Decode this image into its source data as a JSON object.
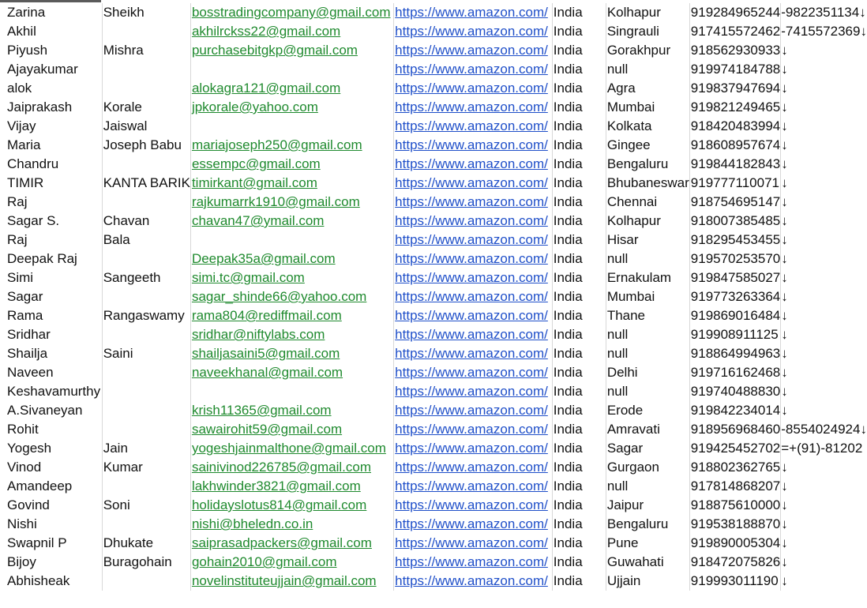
{
  "colors": {
    "email": "#1f8a2e",
    "url": "#1f4fc9",
    "arrow": "#3a8fe0"
  },
  "rows": [
    {
      "first": "Zarina",
      "last": "Sheikh",
      "email": "bosstradingcompany@gmail.com",
      "url": "https://www.amazon.com/",
      "country": "India",
      "city": "Kolhapur",
      "phone": "919284965244",
      "extra": "-9822351134↓"
    },
    {
      "first": "Akhil",
      "last": "",
      "email": "akhilrckss22@gmail.com",
      "url": "https://www.amazon.com/",
      "country": "India",
      "city": "Singrauli",
      "phone": "917415572462",
      "extra": "-7415572369↓"
    },
    {
      "first": "Piyush",
      "last": "Mishra",
      "email": "purchasebitgkp@gmail.com",
      "url": "https://www.amazon.com/",
      "country": "India",
      "city": "Gorakhpur",
      "phone": "918562930933",
      "extra": "↓"
    },
    {
      "first": "Ajayakumar",
      "last": "",
      "email": "",
      "url": "https://www.amazon.com/",
      "country": "India",
      "city": "null",
      "phone": "919974184788",
      "extra": "↓"
    },
    {
      "first": "alok",
      "last": "",
      "email": "alokagra121@gmail.com",
      "url": "https://www.amazon.com/",
      "country": "India",
      "city": "Agra",
      "phone": "919837947694",
      "extra": "↓"
    },
    {
      "first": "Jaiprakash",
      "last": "Korale",
      "email": "jpkorale@yahoo.com",
      "url": "https://www.amazon.com/",
      "country": "India",
      "city": "Mumbai",
      "phone": "919821249465",
      "extra": "↓"
    },
    {
      "first": "Vijay",
      "last": "Jaiswal",
      "email": "",
      "url": "https://www.amazon.com/",
      "country": "India",
      "city": "Kolkata",
      "phone": "918420483994",
      "extra": "↓"
    },
    {
      "first": "Maria",
      "last": "Joseph Babu",
      "email": "mariajoseph250@gmail.com",
      "url": "https://www.amazon.com/",
      "country": "India",
      "city": "Gingee",
      "phone": "918608957674",
      "extra": "↓"
    },
    {
      "first": "Chandru",
      "last": "",
      "email": "essempc@gmail.com",
      "url": "https://www.amazon.com/",
      "country": "India",
      "city": "Bengaluru",
      "phone": "919844182843",
      "extra": "↓"
    },
    {
      "first": "TIMIR",
      "last": "KANTA BARIK",
      "email": "timirkant@gmail.com",
      "url": "https://www.amazon.com/",
      "country": "India",
      "city": "Bhubaneswar",
      "phone": "919777110071",
      "extra": "↓"
    },
    {
      "first": "Raj",
      "last": "",
      "email": "rajkumarrk1910@gmail.com",
      "url": "https://www.amazon.com/",
      "country": "India",
      "city": "Chennai",
      "phone": "918754695147",
      "extra": "↓"
    },
    {
      "first": "Sagar S.",
      "last": "Chavan",
      "email": "chavan47@ymail.com",
      "url": "https://www.amazon.com/",
      "country": "India",
      "city": "Kolhapur",
      "phone": "918007385485",
      "extra": "↓"
    },
    {
      "first": "Raj",
      "last": "Bala",
      "email": "",
      "url": "https://www.amazon.com/",
      "country": "India",
      "city": "Hisar",
      "phone": "918295453455",
      "extra": "↓"
    },
    {
      "first": "Deepak Raj",
      "last": "",
      "email": "Deepak35a@gmail.com",
      "url": "https://www.amazon.com/",
      "country": "India",
      "city": "null",
      "phone": "919570253570",
      "extra": "↓"
    },
    {
      "first": "Simi",
      "last": "Sangeeth",
      "email": "simi.tc@gmail.com",
      "url": "https://www.amazon.com/",
      "country": "India",
      "city": "Ernakulam",
      "phone": "919847585027",
      "extra": "↓"
    },
    {
      "first": "Sagar",
      "last": "",
      "email": "sagar_shinde66@yahoo.com",
      "url": "https://www.amazon.com/",
      "country": "India",
      "city": "Mumbai",
      "phone": "919773263364",
      "extra": "↓"
    },
    {
      "first": "Rama",
      "last": "Rangaswamy",
      "email": "rama804@rediffmail.com",
      "url": "https://www.amazon.com/",
      "country": "India",
      "city": "Thane",
      "phone": "919869016484",
      "extra": "↓"
    },
    {
      "first": "Sridhar",
      "last": "",
      "email": "sridhar@niftylabs.com",
      "url": "https://www.amazon.com/",
      "country": "India",
      "city": "null",
      "phone": "919908911125",
      "extra": "↓"
    },
    {
      "first": "Shailja",
      "last": "Saini",
      "email": "shailjasaini5@gmail.com",
      "url": "https://www.amazon.com/",
      "country": "India",
      "city": "null",
      "phone": "918864994963",
      "extra": "↓"
    },
    {
      "first": "Naveen",
      "last": "",
      "email": "naveekhanal@gmail.com",
      "url": "https://www.amazon.com/",
      "country": "India",
      "city": "Delhi",
      "phone": "919716162468",
      "extra": "↓"
    },
    {
      "first": "Keshavamurthy",
      "last": "",
      "email": "",
      "url": "https://www.amazon.com/",
      "country": "India",
      "city": "null",
      "phone": "919740488830",
      "extra": "↓"
    },
    {
      "first": "A.Sivaneyan",
      "last": "",
      "email": "krish11365@gmail.com",
      "url": "https://www.amazon.com/",
      "country": "India",
      "city": "Erode",
      "phone": "919842234014",
      "extra": "↓"
    },
    {
      "first": "Rohit",
      "last": "",
      "email": "sawairohit59@gmail.com",
      "url": "https://www.amazon.com/",
      "country": "India",
      "city": "Amravati",
      "phone": "918956968460",
      "extra": "-8554024924↓"
    },
    {
      "first": "Yogesh",
      "last": "Jain",
      "email": "yogeshjainmalthone@gmail.com",
      "url": "https://www.amazon.com/",
      "country": "India",
      "city": "Sagar",
      "phone": "919425452702",
      "extra": "=+(91)-81202"
    },
    {
      "first": "Vinod",
      "last": "Kumar",
      "email": "sainivinod226785@gmail.com",
      "url": "https://www.amazon.com/",
      "country": "India",
      "city": "Gurgaon",
      "phone": "918802362765",
      "extra": "↓"
    },
    {
      "first": "Amandeep",
      "last": "",
      "email": "lakhwinder3821@gmail.com",
      "url": "https://www.amazon.com/",
      "country": "India",
      "city": "null",
      "phone": "917814868207",
      "extra": "↓"
    },
    {
      "first": "Govind",
      "last": "Soni",
      "email": "holidayslotus814@gmail.com",
      "url": "https://www.amazon.com/",
      "country": "India",
      "city": "Jaipur",
      "phone": "918875610000",
      "extra": "↓"
    },
    {
      "first": "Nishi",
      "last": "",
      "email": "nishi@bheledn.co.in",
      "url": "https://www.amazon.com/",
      "country": "India",
      "city": "Bengaluru",
      "phone": "919538188870",
      "extra": "↓"
    },
    {
      "first": "Swapnil P",
      "last": "Dhukate",
      "email": "saiprasadpackers@gmail.com",
      "url": "https://www.amazon.com/",
      "country": "India",
      "city": "Pune",
      "phone": "919890005304",
      "extra": "↓"
    },
    {
      "first": "Bijoy",
      "last": "Buragohain",
      "email": "gohain2010@gmail.com",
      "url": "https://www.amazon.com/",
      "country": "India",
      "city": "Guwahati",
      "phone": "918472075826",
      "extra": "↓"
    },
    {
      "first": "Abhisheak",
      "last": "",
      "email": "novelinstituteujjain@gmail.com",
      "url": "https://www.amazon.com/",
      "country": "India",
      "city": "Ujjain",
      "phone": "919993011190",
      "extra": "↓"
    }
  ]
}
